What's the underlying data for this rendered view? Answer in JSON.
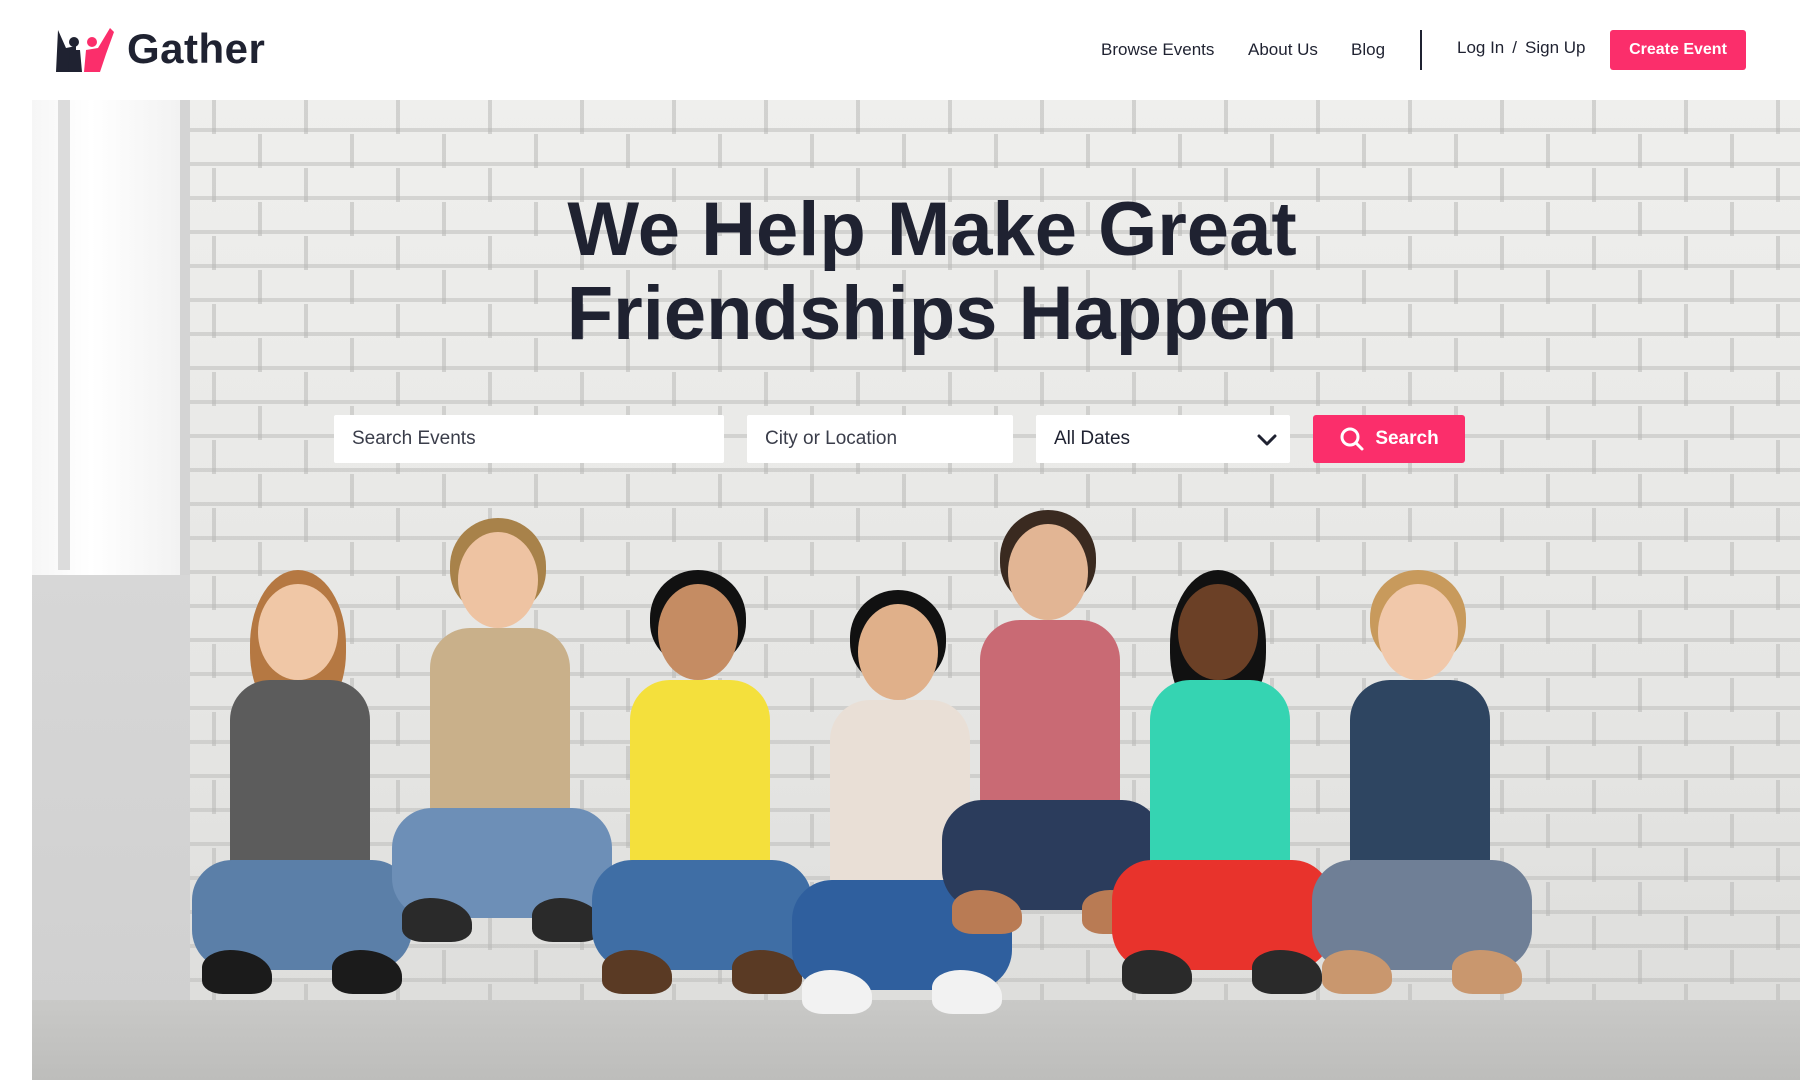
{
  "brand": {
    "name": "Gather",
    "accent_color": "#fb2e6b",
    "text_color": "#1f2231",
    "logo_icon": "people-raising-hands-icon"
  },
  "nav": {
    "links": [
      "Browse Events",
      "About Us",
      "Blog"
    ],
    "login": "Log In",
    "separator": "/",
    "signup": "Sign Up",
    "create_event": "Create Event"
  },
  "hero": {
    "headline_line1": "We Help Make Great",
    "headline_line2": "Friendships Happen",
    "image_description_icon": "group-photo"
  },
  "search": {
    "events_placeholder": "Search Events",
    "location_placeholder": "City or Location",
    "date_select_value": "All Dates",
    "date_icon": "chevron-down-icon",
    "button_label": "Search",
    "button_icon": "search-icon"
  }
}
